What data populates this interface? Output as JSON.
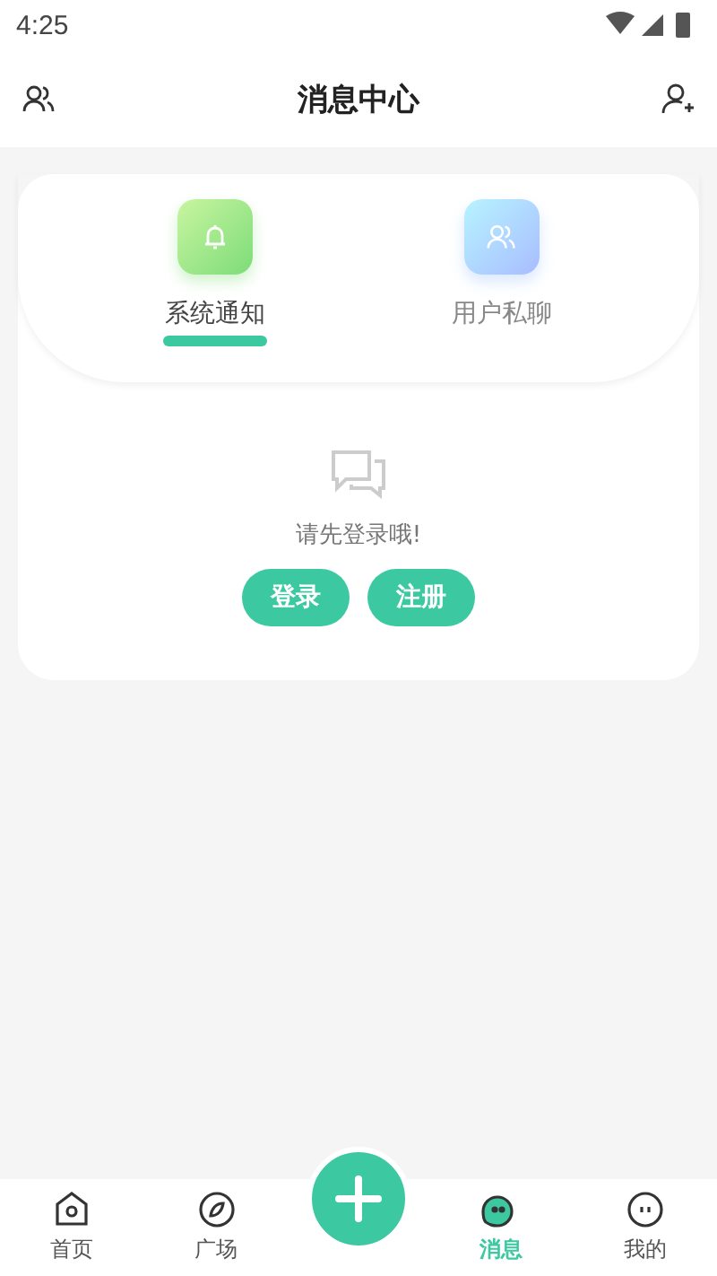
{
  "status_bar": {
    "time": "4:25"
  },
  "header": {
    "title": "消息中心"
  },
  "tabs": [
    {
      "label": "系统通知",
      "kind": "bell",
      "selected": true
    },
    {
      "label": "用户私聊",
      "kind": "users",
      "selected": false
    }
  ],
  "empty_state": {
    "message": "请先登录哦!",
    "buttons": [
      "登录",
      "注册"
    ]
  },
  "bottom_nav": [
    {
      "label": "首页",
      "kind": "home",
      "selected": false
    },
    {
      "label": "广场",
      "kind": "compass",
      "selected": false
    },
    {
      "kind": "add"
    },
    {
      "label": "消息",
      "kind": "chat",
      "selected": true
    },
    {
      "label": "我的",
      "kind": "face",
      "selected": false
    }
  ]
}
